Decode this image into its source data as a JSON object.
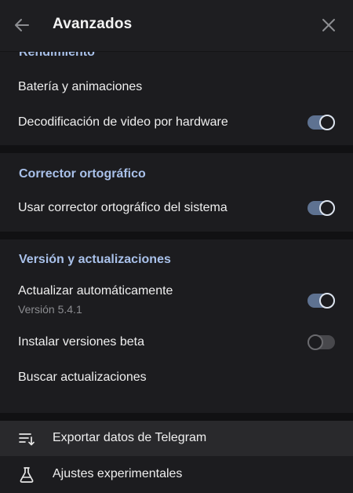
{
  "header": {
    "title": "Avanzados",
    "back_icon": "arrow-left-icon",
    "close_icon": "close-icon"
  },
  "sections": {
    "rendimiento": {
      "title": "Rendimiento",
      "battery_label": "Batería y animaciones",
      "hw_decode_label": "Decodificación de video por hardware",
      "hw_decode_on": true
    },
    "spellcheck": {
      "title": "Corrector ortográfico",
      "system_spell_label": "Usar corrector ortográfico del sistema",
      "system_spell_on": true
    },
    "version": {
      "title": "Versión y actualizaciones",
      "auto_update_label": "Actualizar automáticamente",
      "version_text": "Versión 5.4.1",
      "auto_update_on": true,
      "beta_label": "Instalar versiones beta",
      "beta_on": false,
      "check_updates_label": "Buscar actualizaciones"
    }
  },
  "bottom_items": {
    "export_label": "Exportar datos de Telegram",
    "export_icon": "export-list-icon",
    "experimental_label": "Ajustes experimentales",
    "experimental_icon": "flask-icon"
  },
  "colors": {
    "accent": "#a9c1ea",
    "toggle_on": "#5e7291",
    "background": "#1c1c1f",
    "separator": "#111113"
  }
}
